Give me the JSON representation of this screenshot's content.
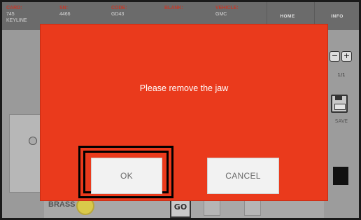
{
  "header": {
    "card": {
      "label": "CARD:",
      "value": "745",
      "value2": "KEYLINE"
    },
    "sn": {
      "label": "SN:",
      "value": "4466"
    },
    "code": {
      "label": "CODE:",
      "value": "GD43"
    },
    "blank": {
      "label": "BLANK:",
      "value": ""
    },
    "vehicle": {
      "label": "VEHICLE:",
      "value": "GMC"
    },
    "home_label": "HOME",
    "info_label": "INFO"
  },
  "right_panel": {
    "minus": "−",
    "plus": "+",
    "page_indicator": "1/1",
    "save_label": "SAVE"
  },
  "bottom_bar": {
    "brass_label": "BRASS",
    "go_label": "GO"
  },
  "modal": {
    "message": "Please remove the jaw",
    "ok_label": "OK",
    "cancel_label": "CANCEL",
    "background_color": "#ea3a1c"
  }
}
